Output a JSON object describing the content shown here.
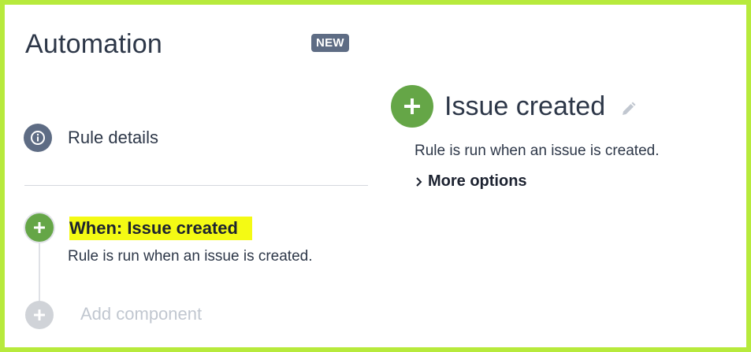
{
  "header": {
    "title": "Automation",
    "badge": "NEW"
  },
  "sidebar": {
    "rule_details_label": "Rule details",
    "trigger": {
      "title": "When: Issue created",
      "description": "Rule is run when an issue is created."
    },
    "add_component_label": "Add component"
  },
  "detail": {
    "title": "Issue created",
    "description": "Rule is run when an issue is created.",
    "more_options_label": "More options"
  },
  "colors": {
    "frame_border": "#b7ea3c",
    "accent_green": "#65a647",
    "highlight_yellow": "#f4fa14",
    "badge_gray": "#5e6c84",
    "muted_gray": "#d0d3d8"
  },
  "icons": {
    "rule_details": "info-icon",
    "trigger": "plus-icon",
    "add_component": "plus-icon",
    "edit": "pencil-icon",
    "more_options": "chevron-right-icon"
  }
}
